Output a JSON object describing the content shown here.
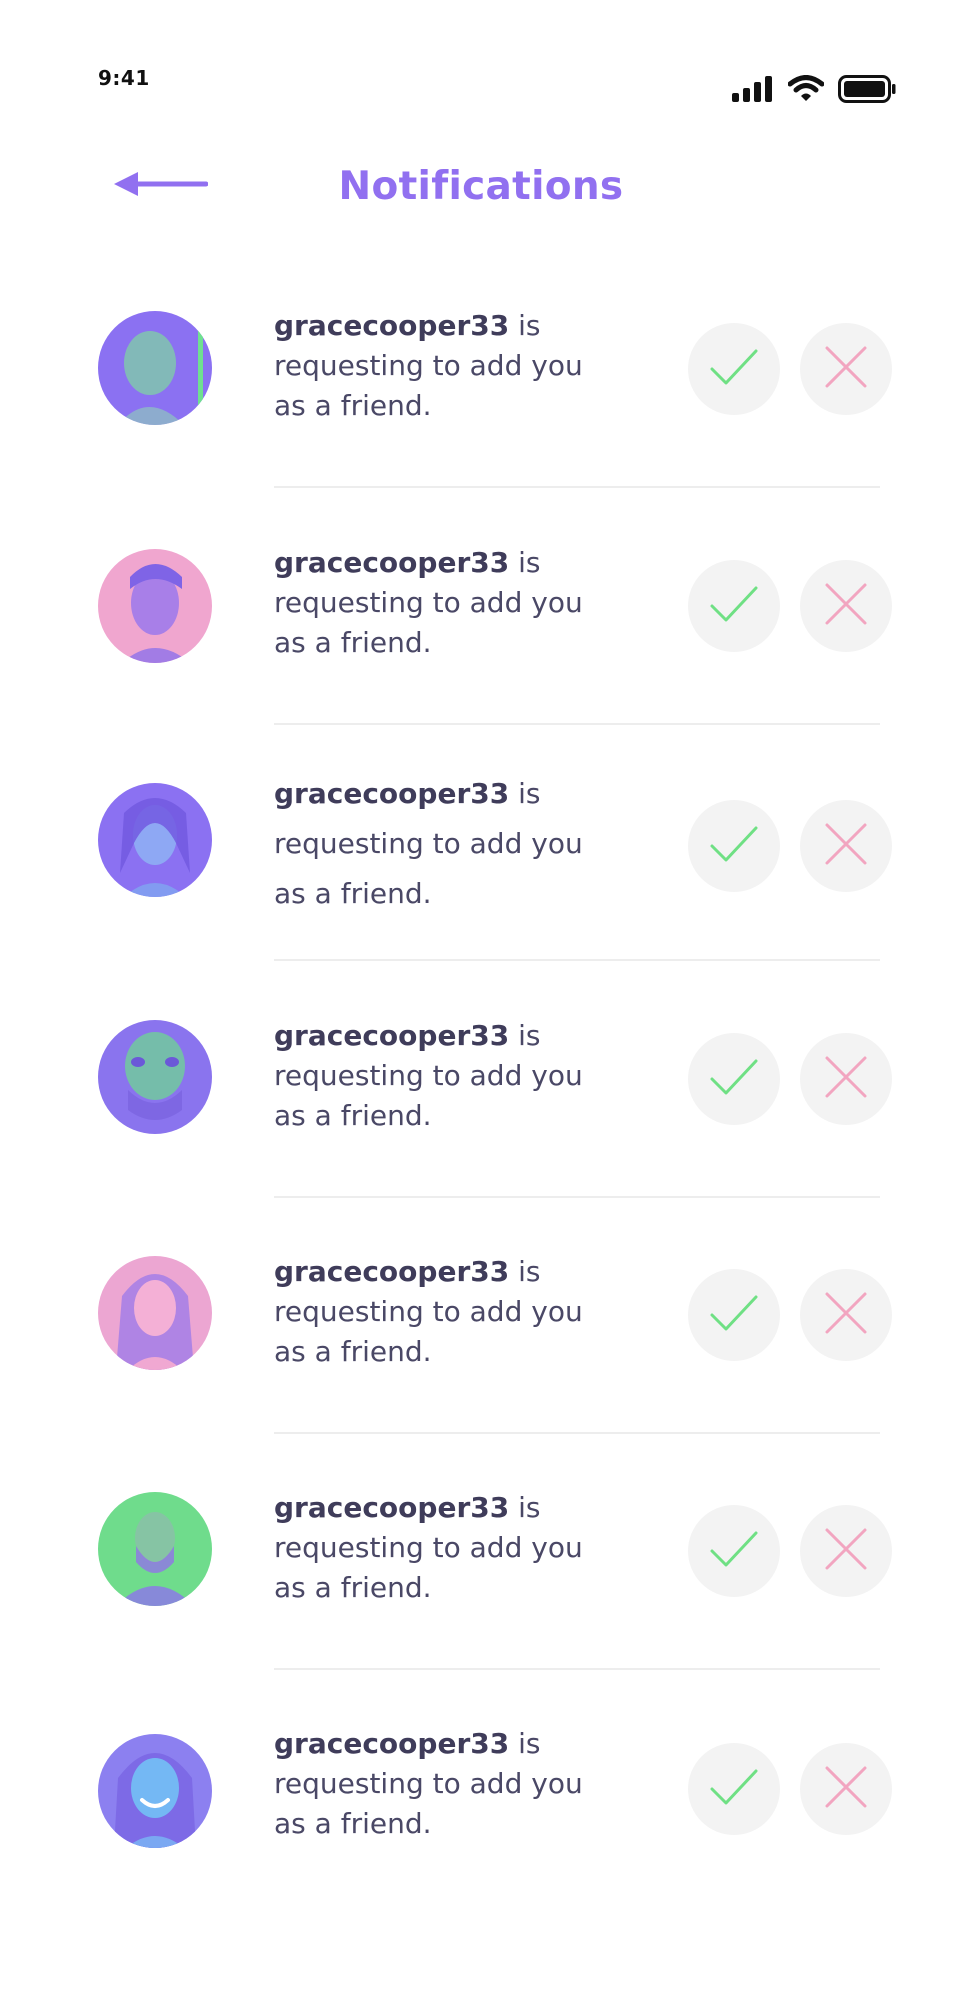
{
  "status_bar": {
    "time": "9:41",
    "icons": [
      "cellular-signal-icon",
      "wifi-icon",
      "battery-icon"
    ]
  },
  "header": {
    "back_icon": "arrow-left-icon",
    "title": "Notifications"
  },
  "colors": {
    "accent": "#9170f0",
    "accept": "#6fe084",
    "decline": "#f2a5c0",
    "button_bg": "#f3f3f3",
    "divider": "#ededed"
  },
  "notifications": [
    {
      "username": "gracecooper33",
      "message": " is requesting to add you as a friend.",
      "accept_icon": "checkmark-icon",
      "decline_icon": "x-icon"
    },
    {
      "username": "gracecooper33",
      "message": " is requesting to add you as a friend.",
      "accept_icon": "checkmark-icon",
      "decline_icon": "x-icon"
    },
    {
      "username": "gracecooper33",
      "message": " is requesting to add you as a friend.",
      "accept_icon": "checkmark-icon",
      "decline_icon": "x-icon"
    },
    {
      "username": "gracecooper33",
      "message": " is requesting to add you as a friend.",
      "accept_icon": "checkmark-icon",
      "decline_icon": "x-icon"
    },
    {
      "username": "gracecooper33",
      "message": " is requesting to add you as a friend.",
      "accept_icon": "checkmark-icon",
      "decline_icon": "x-icon"
    },
    {
      "username": "gracecooper33",
      "message": " is requesting to add you as a friend.",
      "accept_icon": "checkmark-icon",
      "decline_icon": "x-icon"
    },
    {
      "username": "gracecooper33",
      "message": " is requesting to add you as a friend.",
      "accept_icon": "checkmark-icon",
      "decline_icon": "x-icon"
    }
  ]
}
